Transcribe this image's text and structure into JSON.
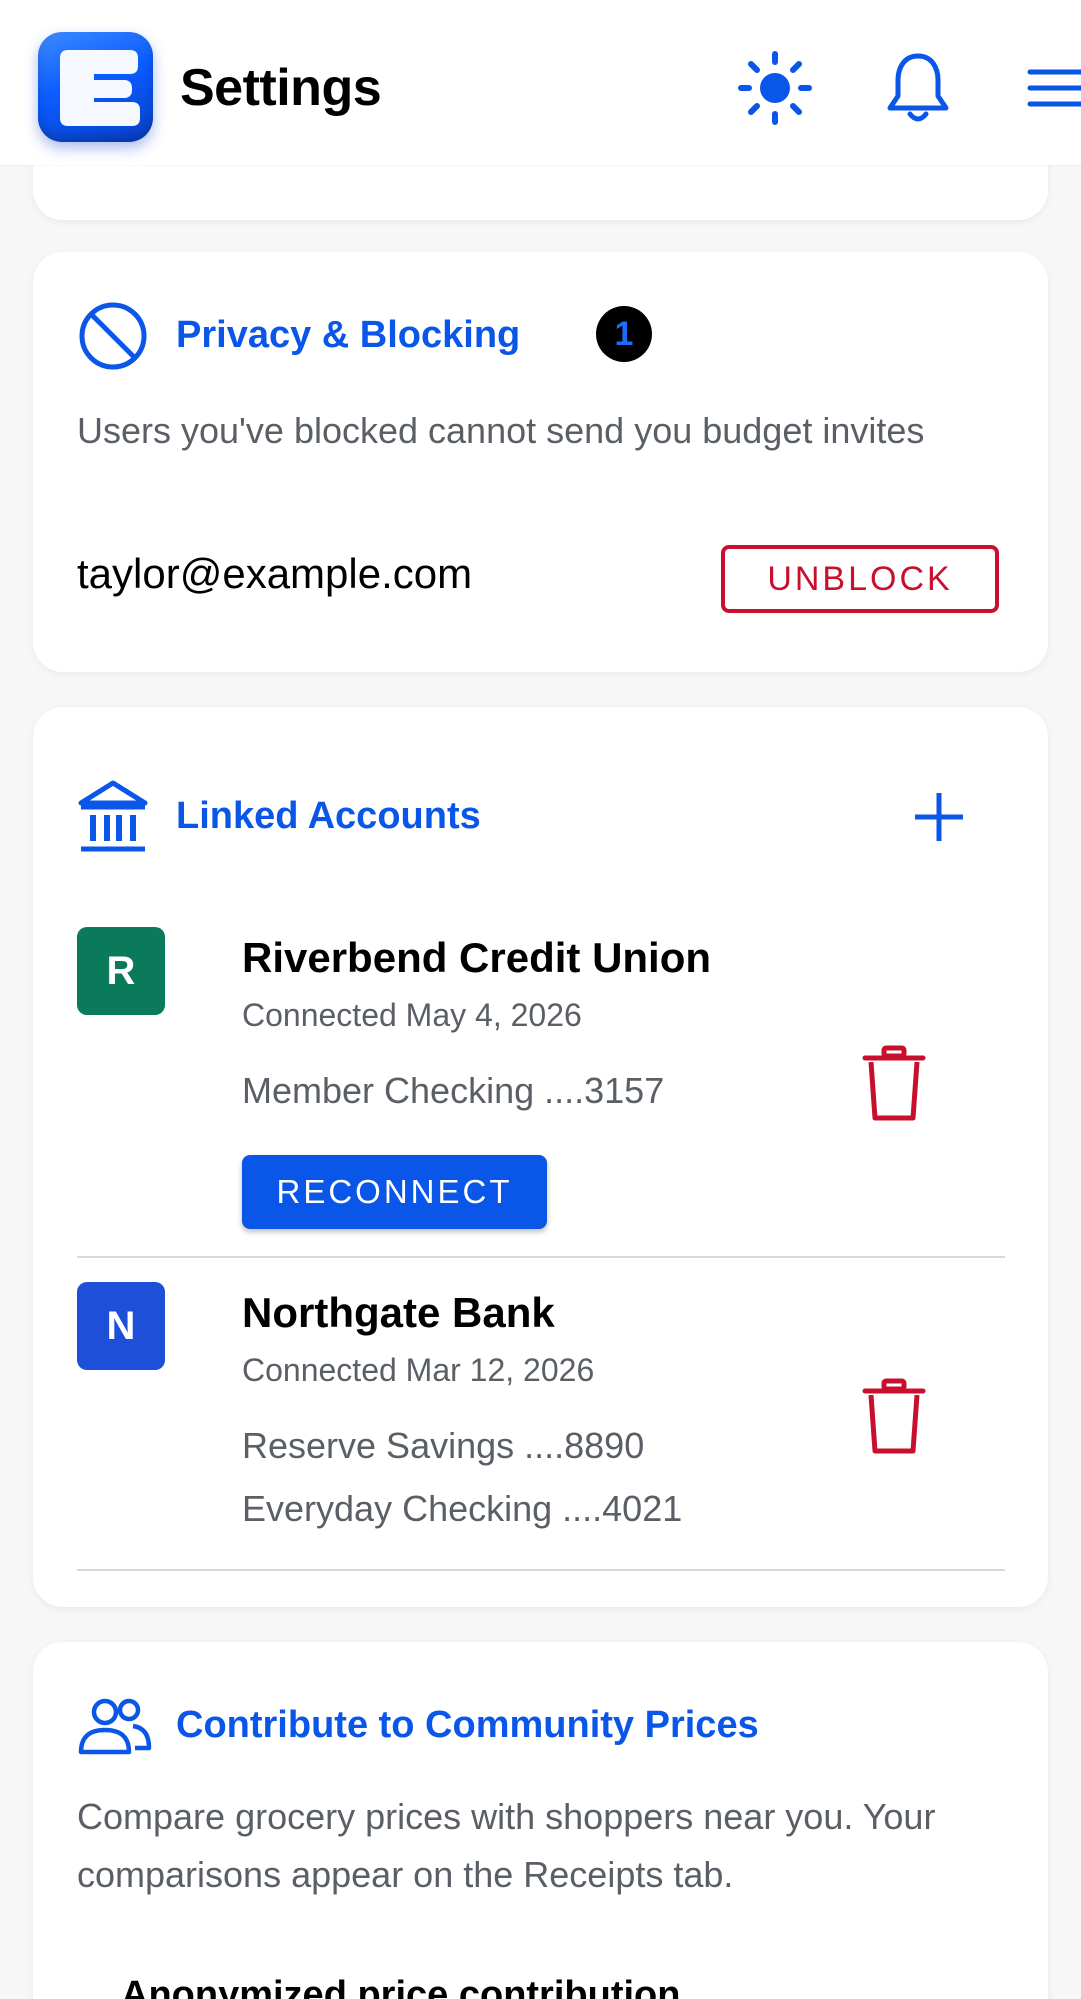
{
  "header": {
    "title": "Settings",
    "logo_letter": "E",
    "icons": [
      "theme-sun-icon",
      "notification-bell-icon",
      "menu-icon"
    ]
  },
  "privacy": {
    "title": "Privacy & Blocking",
    "badge_count": "1",
    "description": "Users you've blocked cannot send you budget invites",
    "blocked_user": "taylor@example.com",
    "unblock_label": "UNBLOCK"
  },
  "linked_accounts": {
    "title": "Linked Accounts",
    "accounts": [
      {
        "initial": "R",
        "name": "Riverbend Credit Union",
        "connected": "Connected May 4, 2026",
        "lines": [
          "Member Checking ....3157"
        ],
        "reconnect_label": "RECONNECT",
        "avatar_color": "#0b7a5b"
      },
      {
        "initial": "N",
        "name": "Northgate Bank",
        "connected": "Connected Mar 12, 2026",
        "lines": [
          "Reserve Savings ....8890",
          "Everyday Checking ....4021"
        ],
        "avatar_color": "#1d4fd8"
      }
    ]
  },
  "community": {
    "title": "Contribute to Community Prices",
    "description": "Compare grocery prices with shoppers near you. Your comparisons appear on the Receipts tab.",
    "option_label": "Anonymized price contribution"
  },
  "colors": {
    "accent": "#0a56e8",
    "danger": "#c8102e",
    "muted_text": "#5a5f66"
  }
}
